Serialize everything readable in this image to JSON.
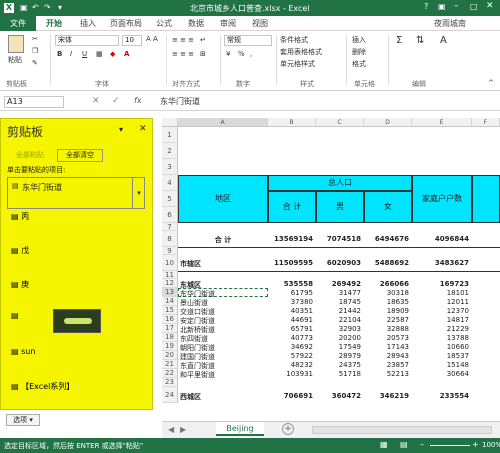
{
  "window": {
    "title": "北京市城乡人口普查.xlsx - Excel",
    "help": "?"
  },
  "tabs": [
    "文件",
    "开始",
    "插入",
    "页面布局",
    "公式",
    "数据",
    "审阅",
    "视图"
  ],
  "user": "夜雨城南",
  "ribbon": {
    "font_name": "宋体",
    "font_size": "10",
    "number_format": "常规",
    "groups": [
      "剪贴板",
      "字体",
      "对齐方式",
      "数字",
      "样式",
      "单元格",
      "编辑"
    ],
    "paste_label": "粘贴",
    "style_items": [
      "条件格式",
      "套用表格格式",
      "单元格样式"
    ],
    "cell_items": [
      "插入",
      "删除",
      "格式"
    ],
    "bold": "B",
    "italic": "I",
    "underline": "U",
    "font_color": "A",
    "currency": "¥",
    "percent": "%",
    "comma": ",",
    "sort": "Σ",
    "edit2": "A"
  },
  "formula": {
    "name_box": "A13",
    "fx": "fx",
    "value": "东华门街道"
  },
  "clipboard": {
    "title": "剪贴板",
    "paste_all": "全部粘贴",
    "clear_all": "全部清空",
    "hint": "单击要粘贴的项目:",
    "items": [
      "东华门街道",
      "丙",
      "戊",
      "庚",
      "sun",
      "【Excel系列】"
    ],
    "options": "选项"
  },
  "sheet": {
    "cols": [
      "A",
      "B",
      "C",
      "D",
      "E",
      "F"
    ],
    "rows": [
      "1",
      "2",
      "3",
      "4",
      "5",
      "6",
      "7",
      "8",
      "9",
      "10",
      "11",
      "12",
      "13",
      "14",
      "15",
      "16",
      "17",
      "18",
      "19",
      "20",
      "21",
      "22",
      "23",
      "24"
    ],
    "header": {
      "region": "地区",
      "total": "总人口",
      "sum": "合  计",
      "male": "男",
      "female": "女",
      "households": "家庭户户数"
    },
    "r8": {
      "a": "合      计",
      "b": "13569194",
      "c": "7074518",
      "d": "6494676",
      "e": "4096844"
    },
    "r10": {
      "a": "市辖区",
      "b": "11509595",
      "c": "6020903",
      "d": "5488692",
      "e": "3483627"
    },
    "r12": {
      "a": "东城区",
      "b": "535558",
      "c": "269492",
      "d": "266066",
      "e": "169723"
    },
    "data": [
      [
        "东华门街道",
        "61795",
        "31477",
        "30318",
        "18101"
      ],
      [
        "景山街道",
        "37380",
        "18745",
        "18635",
        "12011"
      ],
      [
        "交道口街道",
        "40351",
        "21442",
        "18909",
        "12370"
      ],
      [
        "安定门街道",
        "44691",
        "22104",
        "22587",
        "14817"
      ],
      [
        "北新桥街道",
        "65791",
        "32903",
        "32888",
        "21229"
      ],
      [
        "东四街道",
        "40773",
        "20200",
        "20573",
        "13788"
      ],
      [
        "朝阳门街道",
        "34692",
        "17549",
        "17143",
        "10660"
      ],
      [
        "建国门街道",
        "57922",
        "28979",
        "28943",
        "18537"
      ],
      [
        "东直门街道",
        "48232",
        "24375",
        "23857",
        "15148"
      ],
      [
        "和平里街道",
        "103931",
        "51718",
        "52213",
        "30664"
      ]
    ],
    "r24": {
      "a": "西城区",
      "b": "706691",
      "c": "360472",
      "d": "346219",
      "e": "233554"
    },
    "tab": "Beijing"
  },
  "status": {
    "text": "选定目标区域，然后按 ENTER 或选择\"粘贴\"",
    "zoom": "100%"
  },
  "colors": {
    "accent": "#217346",
    "clip_bg": "#f5f500",
    "header_bg": "#00e5ff"
  }
}
